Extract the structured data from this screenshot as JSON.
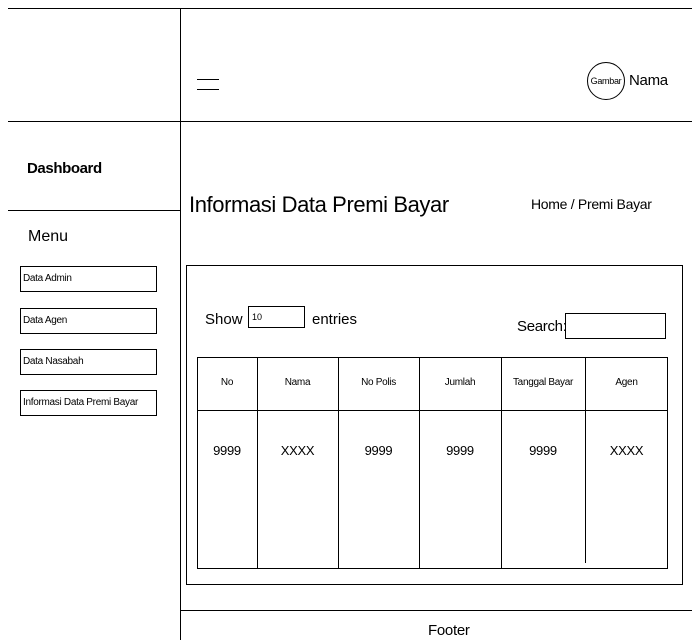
{
  "header": {
    "avatar_text": "Gambar",
    "user_name": "Nama"
  },
  "sidebar": {
    "title": "Dashboard",
    "menu_label": "Menu",
    "items": [
      {
        "label": "Data Admin"
      },
      {
        "label": "Data Agen"
      },
      {
        "label": "Data Nasabah"
      },
      {
        "label": "Informasi Data Premi Bayar"
      }
    ]
  },
  "main": {
    "page_title": "Informasi Data Premi Bayar",
    "breadcrumb": "Home / Premi Bayar",
    "show_label": "Show",
    "entries_value": "10",
    "entries_label": "entries",
    "search_label": "Search:",
    "search_value": ""
  },
  "table": {
    "columns": [
      "No",
      "Nama",
      "No Polis",
      "Jumlah",
      "Tanggal Bayar",
      "Agen"
    ],
    "rows": [
      [
        "9999",
        "XXXX",
        "9999",
        "9999",
        "9999",
        "XXXX"
      ]
    ]
  },
  "footer": {
    "text": "Footer"
  }
}
